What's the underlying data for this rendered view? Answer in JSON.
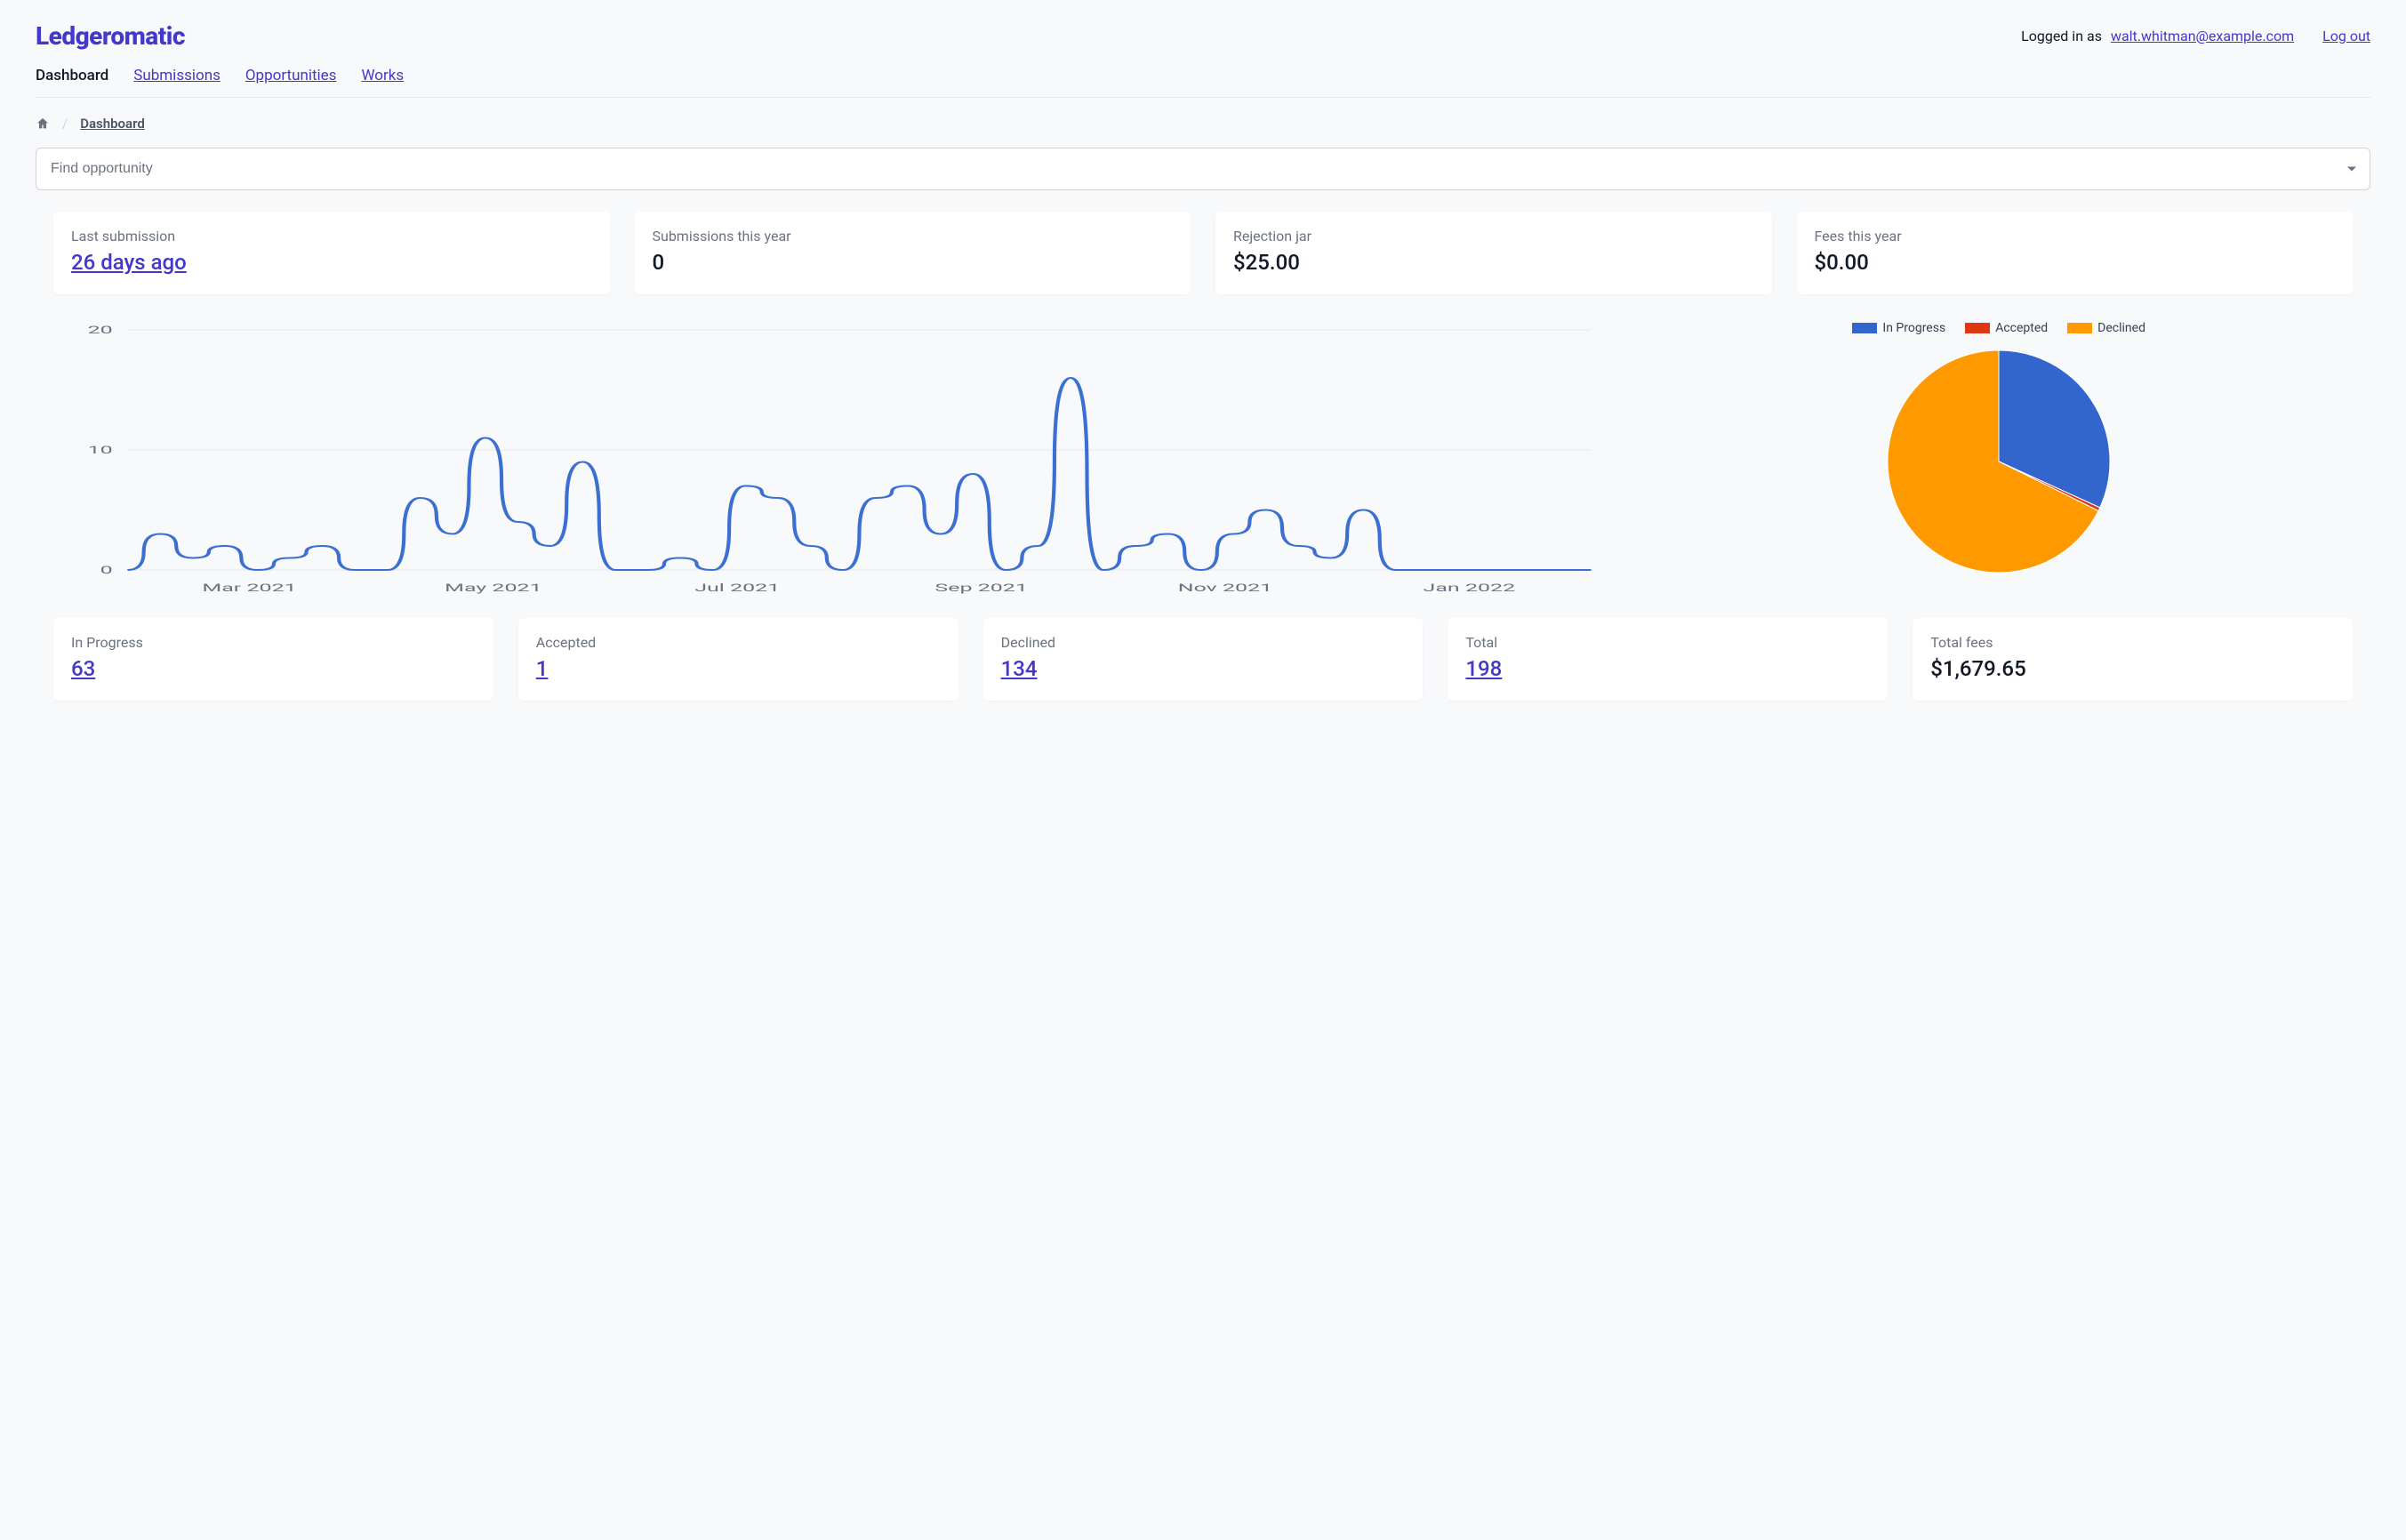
{
  "brand": "Ledgeromatic",
  "auth": {
    "prefix": "Logged in as",
    "email": "walt.whitman@example.com",
    "logout": "Log out"
  },
  "nav": {
    "dashboard": "Dashboard",
    "submissions": "Submissions",
    "opportunities": "Opportunities",
    "works": "Works"
  },
  "breadcrumb": {
    "current": "Dashboard"
  },
  "search": {
    "placeholder": "Find opportunity"
  },
  "top_cards": {
    "last_submission": {
      "label": "Last submission",
      "value": "26 days ago",
      "link": true
    },
    "submissions_year": {
      "label": "Submissions this year",
      "value": "0",
      "link": false
    },
    "rejection_jar": {
      "label": "Rejection jar",
      "value": "$25.00",
      "link": false
    },
    "fees_year": {
      "label": "Fees this year",
      "value": "$0.00",
      "link": false
    }
  },
  "bottom_cards": {
    "in_progress": {
      "label": "In Progress",
      "value": "63",
      "link": true
    },
    "accepted": {
      "label": "Accepted",
      "value": "1",
      "link": true
    },
    "declined": {
      "label": "Declined",
      "value": "134",
      "link": true
    },
    "total": {
      "label": "Total",
      "value": "198",
      "link": true
    },
    "total_fees": {
      "label": "Total fees",
      "value": "$1,679.65",
      "link": false
    }
  },
  "colors": {
    "in_progress": "#3366cc",
    "accepted": "#dc3912",
    "declined": "#ff9900",
    "line": "#3b6fd1"
  },
  "pie_legend": {
    "in_progress": "In Progress",
    "accepted": "Accepted",
    "declined": "Declined"
  },
  "chart_data": [
    {
      "type": "line",
      "title": "",
      "xlabel": "",
      "ylabel": "",
      "ylim": [
        0,
        20
      ],
      "y_ticks": [
        0,
        10,
        20
      ],
      "x_ticks": [
        "Mar 2021",
        "May 2021",
        "Jul 2021",
        "Sep 2021",
        "Nov 2021",
        "Jan 2022"
      ],
      "x": [
        0,
        1,
        2,
        3,
        4,
        5,
        6,
        7,
        8,
        9,
        10,
        11,
        12,
        13,
        14,
        15,
        16,
        17,
        18,
        19,
        20,
        21,
        22,
        23,
        24,
        25,
        26,
        27,
        28,
        29,
        30,
        31,
        32,
        33,
        34,
        35,
        36,
        37,
        38,
        39,
        40,
        41,
        42,
        43,
        44,
        45
      ],
      "values": [
        0,
        3,
        1,
        2,
        0,
        1,
        2,
        0,
        0,
        6,
        3,
        11,
        4,
        2,
        9,
        0,
        0,
        1,
        0,
        7,
        6,
        2,
        0,
        6,
        7,
        3,
        8,
        0,
        2,
        16,
        0,
        2,
        3,
        0,
        3,
        5,
        2,
        1,
        5,
        0,
        0,
        0,
        0,
        0,
        0,
        0
      ]
    },
    {
      "type": "pie",
      "title": "",
      "series": [
        {
          "name": "In Progress",
          "value": 63
        },
        {
          "name": "Accepted",
          "value": 1
        },
        {
          "name": "Declined",
          "value": 134
        }
      ]
    }
  ]
}
